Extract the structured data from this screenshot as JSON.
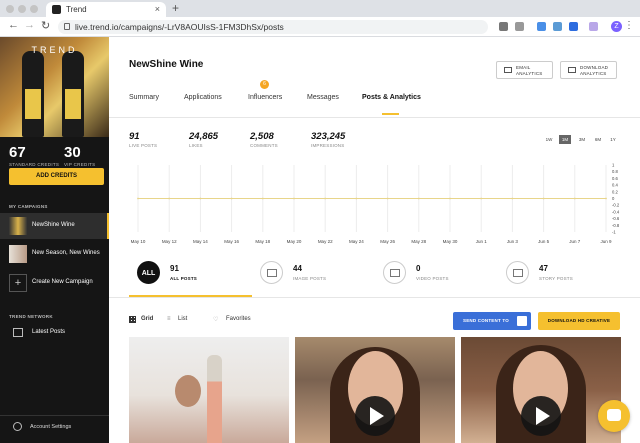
{
  "browser": {
    "tab_title": "Trend",
    "tab_close": "×",
    "new_tab": "+",
    "back": "←",
    "forward": "→",
    "reload": "↻",
    "url": "live.trend.io/campaigns/-LrV8AOUIsS-1FM3DhSx/posts",
    "profile_initial": "Z",
    "menu": "⋮"
  },
  "sidebar": {
    "brand": "TREND",
    "standard_credits": "67",
    "standard_credits_label": "STANDARD CREDITS",
    "vip_credits": "30",
    "vip_credits_label": "VIP CREDITS",
    "add_credits": "ADD CREDITS",
    "my_campaigns_title": "MY CAMPAIGNS",
    "campaigns": [
      {
        "name": "NewShine Wine",
        "active": true
      },
      {
        "name": "New Season, New Wines",
        "active": false
      }
    ],
    "create_campaign": "Create New Campaign",
    "create_plus": "+",
    "trend_network_title": "TREND NETWORK",
    "latest_posts": "Latest Posts",
    "account_settings": "Account Settings"
  },
  "header": {
    "title": "NewShine Wine",
    "email_analytics": [
      "EMAIL",
      "ANALYTICS"
    ],
    "download_analytics": [
      "DOWNLOAD",
      "ANALYTICS"
    ]
  },
  "tabs": [
    {
      "label": "Summary"
    },
    {
      "label": "Applications"
    },
    {
      "label": "Influencers",
      "badge": "6"
    },
    {
      "label": "Messages"
    },
    {
      "label": "Posts & Analytics",
      "active": true
    }
  ],
  "stats": [
    {
      "value": "91",
      "label": "LIVE POSTS"
    },
    {
      "value": "24,865",
      "label": "LIKES"
    },
    {
      "value": "2,508",
      "label": "COMMENTS"
    },
    {
      "value": "323,245",
      "label": "IMPRESSIONS"
    }
  ],
  "ranges": [
    {
      "label": "1W"
    },
    {
      "label": "1M",
      "active": true
    },
    {
      "label": "3M"
    },
    {
      "label": "6M"
    },
    {
      "label": "1Y"
    }
  ],
  "chart_data": {
    "type": "line",
    "x": [
      "May 10",
      "May 12",
      "May 14",
      "May 16",
      "May 18",
      "May 20",
      "May 22",
      "May 24",
      "May 26",
      "May 28",
      "May 30",
      "Jun 1",
      "Jun 3",
      "Jun 5",
      "Jun 7",
      "Jun 9"
    ],
    "series": [
      {
        "values": [
          0,
          0,
          0,
          0,
          0,
          0,
          0,
          0,
          0,
          0,
          0,
          0,
          0,
          0,
          0,
          0
        ]
      }
    ],
    "y_ticks": [
      "1",
      "0.8",
      "0.6",
      "0.4",
      "0.2",
      "0",
      "-0.2",
      "-0.4",
      "-0.6",
      "-0.8",
      "-1"
    ],
    "ylim": [
      -1,
      1
    ],
    "grid": true,
    "line_color": "#e8d58a"
  },
  "post_tabs": [
    {
      "icon_text": "ALL",
      "count": "91",
      "label": "ALL POSTS",
      "active": true
    },
    {
      "count": "44",
      "label": "IMAGE POSTS"
    },
    {
      "count": "0",
      "label": "VIDEO POSTS"
    },
    {
      "count": "47",
      "label": "STORY POSTS"
    }
  ],
  "toolbar": {
    "grid": "Grid",
    "list": "List",
    "favorites": "Favorites",
    "send_content": "SEND CONTENT TO",
    "download_hd": "DOWNLOAD HD CREATIVE"
  },
  "colors": {
    "accent": "#f5c02f",
    "send_button": "#3a6fd8",
    "sidebar_bg": "#151515"
  }
}
